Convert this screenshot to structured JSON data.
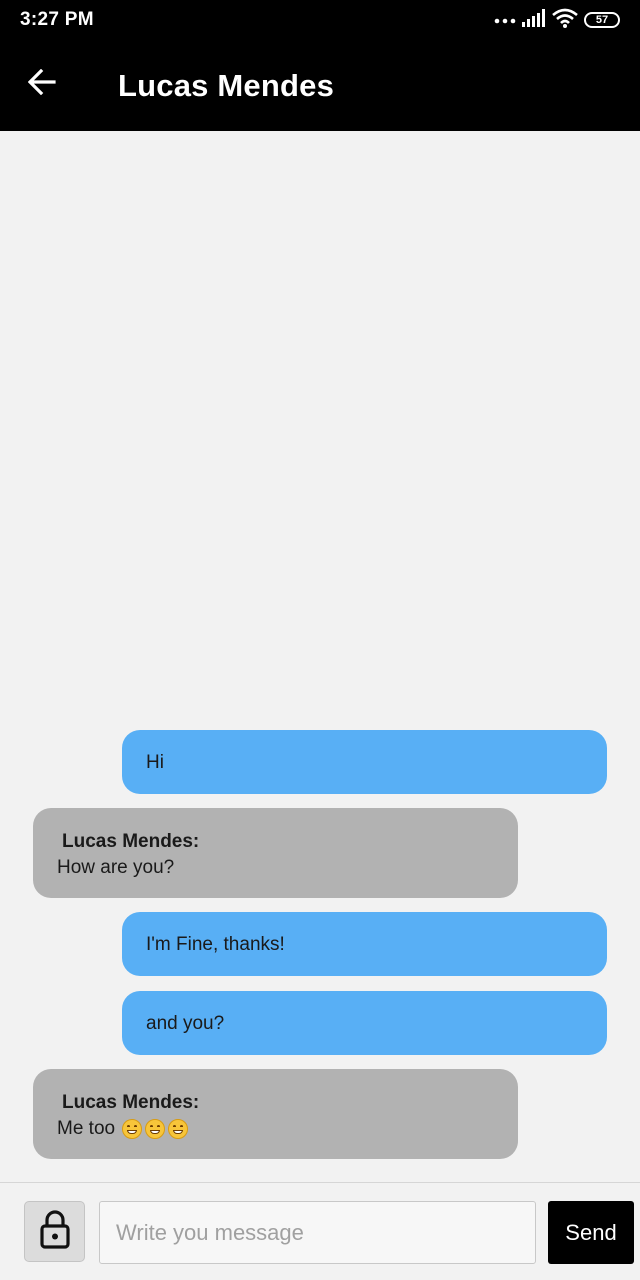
{
  "status_bar": {
    "time": "3:27 PM",
    "battery": "57"
  },
  "header": {
    "title": "Lucas Mendes"
  },
  "messages": [
    {
      "direction": "outgoing",
      "text": "Hi"
    },
    {
      "direction": "incoming",
      "sender": "Lucas Mendes:",
      "text": "How are you?"
    },
    {
      "direction": "outgoing",
      "text": "I'm Fine, thanks!"
    },
    {
      "direction": "outgoing",
      "text": "and you?"
    },
    {
      "direction": "incoming",
      "sender": "Lucas Mendes:",
      "text": "Me too",
      "emoji_count": 3
    }
  ],
  "composer": {
    "placeholder": "Write you message",
    "send_label": "Send"
  },
  "colors": {
    "outgoing_bubble": "#58aff5",
    "incoming_bubble": "#b2b2b2",
    "bars": "#000000"
  }
}
